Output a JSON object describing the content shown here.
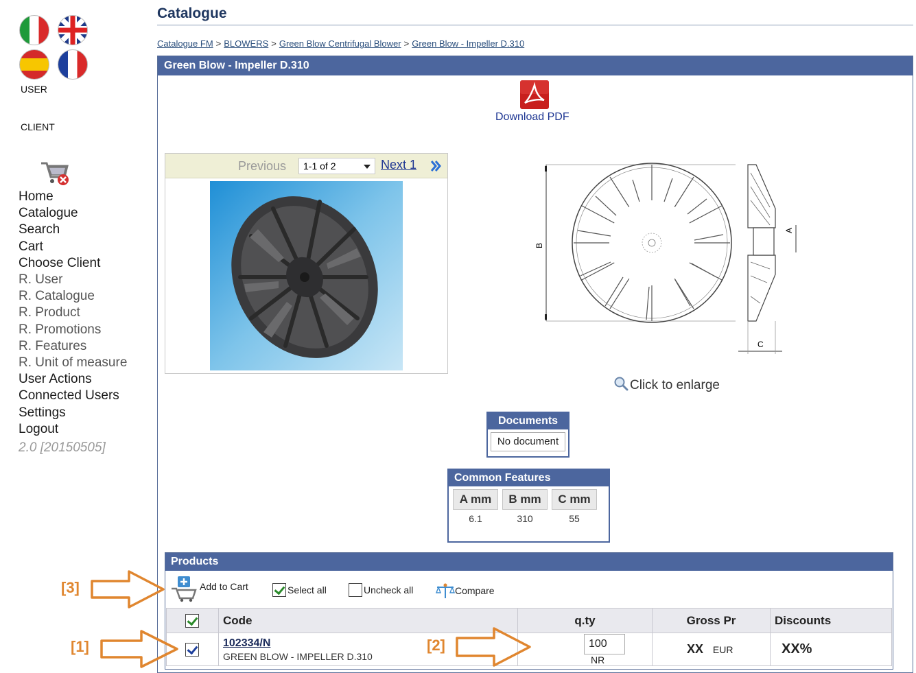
{
  "sidebar": {
    "user_label": "USER",
    "client_label": "CLIENT",
    "nav": [
      {
        "label": "Home",
        "restricted": false
      },
      {
        "label": "Catalogue",
        "restricted": false
      },
      {
        "label": "Search",
        "restricted": false
      },
      {
        "label": "Cart",
        "restricted": false
      },
      {
        "label": "Choose Client",
        "restricted": false
      },
      {
        "label": "R. User",
        "restricted": true
      },
      {
        "label": "R. Catalogue",
        "restricted": true
      },
      {
        "label": "R. Product",
        "restricted": true
      },
      {
        "label": "R. Promotions",
        "restricted": true
      },
      {
        "label": "R. Features",
        "restricted": true
      },
      {
        "label": "R. Unit of measure",
        "restricted": true
      },
      {
        "label": "User Actions",
        "restricted": false
      },
      {
        "label": "Connected Users",
        "restricted": false
      },
      {
        "label": "Settings",
        "restricted": false
      },
      {
        "label": "Logout",
        "restricted": false
      }
    ],
    "version": "2.0 [20150505]"
  },
  "header": {
    "title": "Catalogue",
    "breadcrumb": [
      "Catalogue FM",
      "BLOWERS",
      "Green Blow Centrifugal Blower",
      "Green Blow - Impeller D.310"
    ],
    "separator": ">"
  },
  "panel": {
    "title": "Green Blow - Impeller D.310",
    "pdf_label": "Download PDF",
    "pager": {
      "previous": "Previous",
      "selected": "1-1 of 2",
      "next": "Next 1"
    },
    "enlarge_label": "Click to enlarge",
    "drawing_dims": {
      "a": "A",
      "b": "B",
      "c": "C"
    }
  },
  "documents": {
    "title": "Documents",
    "empty": "No document"
  },
  "features": {
    "title": "Common Features",
    "headers": [
      "A mm",
      "B mm",
      "C mm"
    ],
    "values": [
      "6.1",
      "310",
      "55"
    ]
  },
  "products": {
    "title": "Products",
    "toolbar": {
      "add_to_cart": "Add to Cart",
      "select_all": "Select all",
      "uncheck_all": "Uncheck all",
      "compare": "Compare"
    },
    "columns": {
      "code": "Code",
      "qty": "q.ty",
      "gross": "Gross Pr",
      "discounts": "Discounts"
    },
    "rows": [
      {
        "code": "102334/N",
        "description": "GREEN BLOW - IMPELLER D.310",
        "qty": "100",
        "unit": "NR",
        "gross": "XX",
        "currency": "EUR",
        "discount": "XX%"
      }
    ]
  },
  "annotations": {
    "a1": "[1]",
    "a2": "[2]",
    "a3": "[3]"
  },
  "colors": {
    "header_blue": "#4c669e",
    "title_blue": "#1f3760",
    "annotation_orange": "#e0862f"
  }
}
